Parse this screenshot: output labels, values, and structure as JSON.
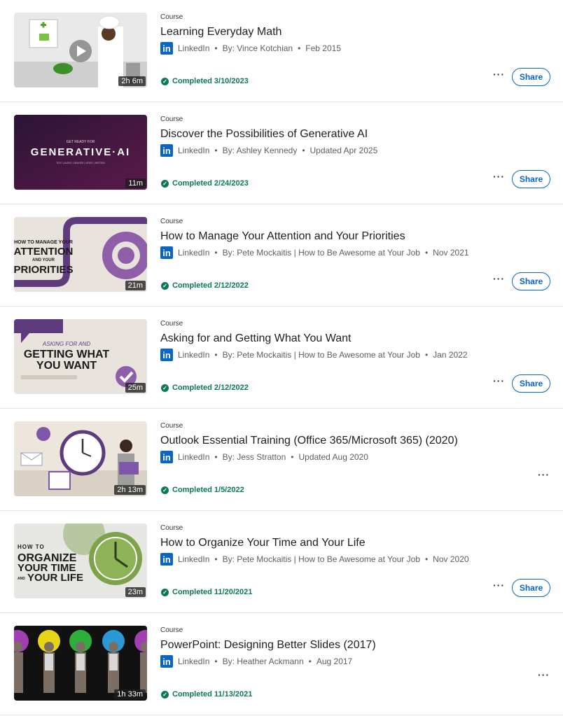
{
  "courses": [
    {
      "type": "Course",
      "title": "Learning Everyday Math",
      "provider": "LinkedIn",
      "author": "By: Vince Kotchian",
      "date": "Feb 2015",
      "completed": "Completed 3/10/2023",
      "duration": "2h 6m",
      "share": "Share"
    },
    {
      "type": "Course",
      "title": "Discover the Possibilities of Generative AI",
      "provider": "LinkedIn",
      "author": "By: Ashley Kennedy",
      "date": "Updated Apr 2025",
      "completed": "Completed 2/24/2023",
      "duration": "11m",
      "share": "Share",
      "thumb_text_small": "GET READY FOR",
      "thumb_text": "GENERATIVE·AI",
      "thumb_text_sub": "TEXT | AUDIO | IMAGES | VIDEO | MOTION"
    },
    {
      "type": "Course",
      "title": "How to Manage Your Attention and Your Priorities",
      "provider": "LinkedIn",
      "author": "By: Pete Mockaitis | How to Be Awesome at Your Job",
      "date": "Nov 2021",
      "completed": "Completed 2/12/2022",
      "duration": "21m",
      "share": "Share",
      "thumb_l1": "HOW TO MANAGE YOUR",
      "thumb_l2": "ATTENTION",
      "thumb_l3": "AND YOUR",
      "thumb_l4": "PRIORITIES"
    },
    {
      "type": "Course",
      "title": "Asking for and Getting What You Want",
      "provider": "LinkedIn",
      "author": "By: Pete Mockaitis | How to Be Awesome at Your Job",
      "date": "Jan 2022",
      "completed": "Completed 2/12/2022",
      "duration": "25m",
      "share": "Share",
      "thumb_l1": "ASKING FOR AND",
      "thumb_l2": "GETTING WHAT",
      "thumb_l3": "YOU WANT"
    },
    {
      "type": "Course",
      "title": "Outlook Essential Training (Office 365/Microsoft 365) (2020)",
      "provider": "LinkedIn",
      "author": "By: Jess Stratton",
      "date": "Updated Aug 2020",
      "completed": "Completed 1/5/2022",
      "duration": "2h 13m",
      "share": ""
    },
    {
      "type": "Course",
      "title": "How to Organize Your Time and Your Life",
      "provider": "LinkedIn",
      "author": "By: Pete Mockaitis | How to Be Awesome at Your Job",
      "date": "Nov 2020",
      "completed": "Completed 11/20/2021",
      "duration": "23m",
      "share": "Share",
      "thumb_l1": "HOW TO",
      "thumb_l2": "ORGANIZE",
      "thumb_l3": "YOUR TIME",
      "thumb_l4": "YOUR LIFE",
      "thumb_and": "AND"
    },
    {
      "type": "Course",
      "title": "PowerPoint: Designing Better Slides (2017)",
      "provider": "LinkedIn",
      "author": "By: Heather Ackmann",
      "date": "Aug 2017",
      "completed": "Completed 11/13/2021",
      "duration": "1h 33m",
      "share": ""
    }
  ],
  "more_label": "···",
  "li_glyph": "in",
  "dot": "•",
  "check_glyph": "✓"
}
